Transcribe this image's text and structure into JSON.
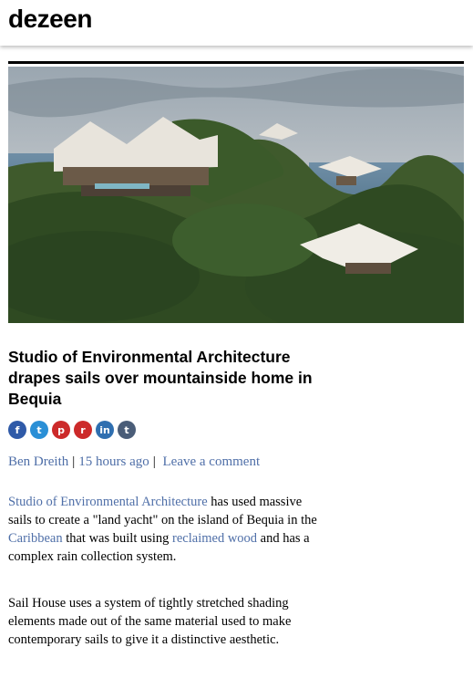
{
  "header": {
    "logo": "dezeen"
  },
  "article": {
    "title": "Studio of Environmental Architecture drapes sails over mountainside home in Bequia",
    "share_icons": [
      {
        "name": "facebook-icon",
        "glyph": "f"
      },
      {
        "name": "twitter-icon",
        "glyph": "t"
      },
      {
        "name": "pinterest-icon",
        "glyph": "p"
      },
      {
        "name": "reddit-icon",
        "glyph": "r"
      },
      {
        "name": "linkedin-icon",
        "glyph": "in"
      },
      {
        "name": "tumblr-icon",
        "glyph": "t"
      }
    ],
    "byline": {
      "author": "Ben Dreith",
      "separator": "|",
      "time": "15 hours ago",
      "comment": "Leave a comment"
    },
    "p1": {
      "link1": "Studio of Environmental Architecture",
      "text1": " has used massive sails to create a \"land yacht\" on the island of Bequia in the ",
      "link2": "Caribbean",
      "text2": " that was built using ",
      "link3": "reclaimed wood",
      "text3": " and has a complex rain collection system."
    },
    "p2": "Sail House uses a system of tightly stretched shading elements made out of the same material used to make contemporary sails to give it a distinctive aesthetic."
  },
  "colors": {
    "link": "#4f6fa8",
    "share": "#2f5aa8",
    "reddit": "#cc2a2a"
  }
}
